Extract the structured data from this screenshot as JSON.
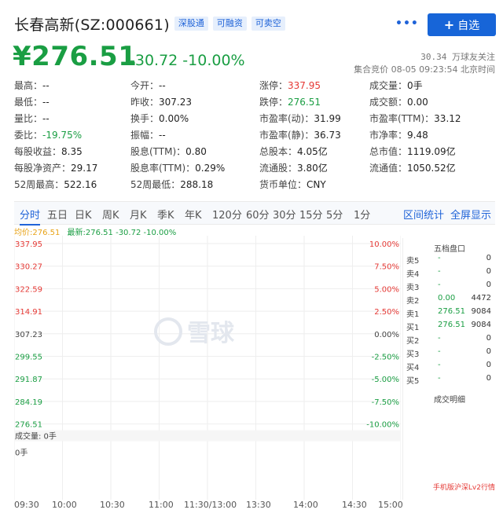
{
  "header": {
    "title": "长春高新(SZ:000661)",
    "tags": [
      "深股通",
      "可融资",
      "可卖空"
    ],
    "more": "•••",
    "add_fav": "自选"
  },
  "quote": {
    "price": "¥276.51",
    "change": "-30.72",
    "change_pct": "-10.00%",
    "market_cap_note": "30.34 万球友关注",
    "time_note": "集合竞价 08-05 09:23:54 北京时间"
  },
  "stats": [
    [
      {
        "k": "最高：",
        "v": "--"
      },
      {
        "k": "今开：",
        "v": "--"
      },
      {
        "k": "涨停：",
        "v": "337.95",
        "c": "red"
      },
      {
        "k": "成交量：",
        "v": "0手"
      }
    ],
    [
      {
        "k": "最低：",
        "v": "--"
      },
      {
        "k": "昨收：",
        "v": "307.23"
      },
      {
        "k": "跌停：",
        "v": "276.51",
        "c": "green"
      },
      {
        "k": "成交额：",
        "v": "0.00"
      }
    ],
    [
      {
        "k": "量比：",
        "v": "--"
      },
      {
        "k": "换手：",
        "v": "0.00%"
      },
      {
        "k": "市盈率(动)：",
        "v": "31.99"
      },
      {
        "k": "市盈率(TTM)：",
        "v": "33.12"
      }
    ],
    [
      {
        "k": "委比：",
        "v": "-19.75%",
        "c": "green"
      },
      {
        "k": "振幅：",
        "v": "--"
      },
      {
        "k": "市盈率(静)：",
        "v": "36.73"
      },
      {
        "k": "市净率：",
        "v": "9.48"
      }
    ],
    [
      {
        "k": "每股收益：",
        "v": "8.35"
      },
      {
        "k": "股息(TTM)：",
        "v": "0.80"
      },
      {
        "k": "总股本：",
        "v": "4.05亿"
      },
      {
        "k": "总市值：",
        "v": "1119.09亿"
      }
    ],
    [
      {
        "k": "每股净资产：",
        "v": "29.17"
      },
      {
        "k": "股息率(TTM)：",
        "v": "0.29%"
      },
      {
        "k": "流通股：",
        "v": "3.80亿"
      },
      {
        "k": "流通值：",
        "v": "1050.52亿"
      }
    ],
    [
      {
        "k": "52周最高：",
        "v": "522.16"
      },
      {
        "k": "52周最低：",
        "v": "288.18"
      },
      {
        "k": "货币单位：",
        "v": "CNY"
      }
    ]
  ],
  "tabs": [
    "分时",
    "五日",
    "日K",
    "周K",
    "月K",
    "季K",
    "年K",
    "120分",
    "60分",
    "30分",
    "15分",
    "5分",
    "1分"
  ],
  "tabs_right": [
    "区间统计",
    "全屏显示"
  ],
  "legend": {
    "avg": "均价:276.51",
    "latest": "最新:276.51 -30.72 -10.00%"
  },
  "chart_data": {
    "type": "line",
    "y_left": [
      "337.95",
      "330.27",
      "322.59",
      "314.91",
      "307.23",
      "299.55",
      "291.87",
      "284.19",
      "276.51"
    ],
    "y_right": [
      "10.00%",
      "7.50%",
      "5.00%",
      "2.50%",
      "0.00%",
      "-2.50%",
      "-5.00%",
      "-7.50%",
      "-10.00%"
    ],
    "x": [
      "09:30",
      "10:00",
      "10:30",
      "11:00",
      "11:30/13:00",
      "13:30",
      "14:00",
      "14:30",
      "15:00"
    ],
    "volume_label": "成交量: 0手",
    "volume_value": "0手",
    "watermark": "雪球",
    "colors": {
      "red": "#e53935",
      "green": "#1a9e43",
      "grid": "#eeeeee"
    }
  },
  "orderbook": {
    "title": "五档盘口",
    "rows": [
      {
        "n": "卖5",
        "p": "-",
        "q": "0"
      },
      {
        "n": "卖4",
        "p": "-",
        "q": "0"
      },
      {
        "n": "卖3",
        "p": "-",
        "q": "0"
      },
      {
        "n": "卖2",
        "p": "0.00",
        "q": "4472"
      },
      {
        "n": "卖1",
        "p": "276.51",
        "q": "9084"
      },
      {
        "n": "买1",
        "p": "276.51",
        "q": "9084"
      },
      {
        "n": "买2",
        "p": "-",
        "q": "0"
      },
      {
        "n": "买3",
        "p": "-",
        "q": "0"
      },
      {
        "n": "买4",
        "p": "-",
        "q": "0"
      },
      {
        "n": "买5",
        "p": "-",
        "q": "0"
      }
    ],
    "detail_title": "成交明细",
    "note": "手机版沪深Lv2行情"
  }
}
